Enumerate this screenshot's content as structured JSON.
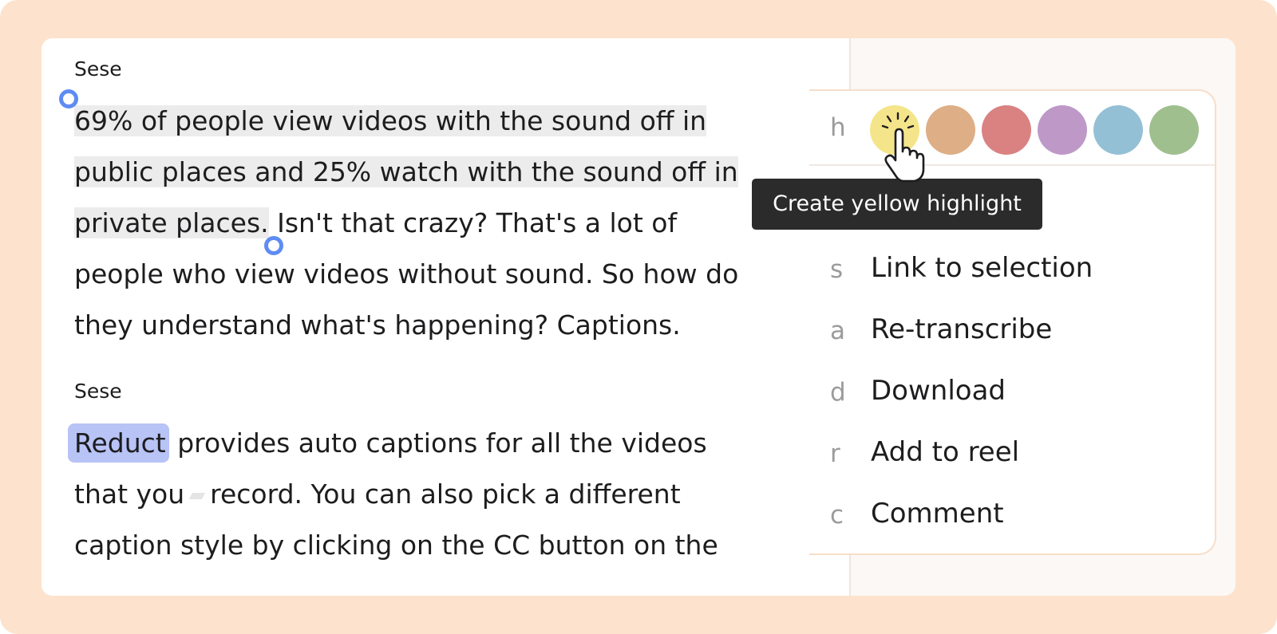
{
  "transcript": {
    "blocks": [
      {
        "speaker": "Sese",
        "lines": [
          {
            "selected": "69% of people view videos with the sound off in",
            "rest": ""
          },
          {
            "selected": "public places and 25% watch with the sound off in",
            "rest": ""
          },
          {
            "selected": "private places.",
            "rest": " Isn't that crazy? That's a lot of"
          },
          {
            "selected": "",
            "rest": "people who view videos without sound. So how do"
          },
          {
            "selected": "",
            "rest": "they understand what's happening? Captions."
          }
        ]
      },
      {
        "speaker": "Sese",
        "highlighted_word": "Reduct",
        "lines": [
          " provides auto captions for all the videos",
          "that you",
          "record. You can also pick a different",
          "caption style by clicking on the CC button on the"
        ]
      }
    ]
  },
  "highlight_menu": {
    "shortcut_key": "h",
    "colors": [
      {
        "name": "yellow",
        "hex": "#f5e58a"
      },
      {
        "name": "orange",
        "hex": "#deae86"
      },
      {
        "name": "red",
        "hex": "#d98281"
      },
      {
        "name": "purple",
        "hex": "#be99c8"
      },
      {
        "name": "blue",
        "hex": "#94c0d6"
      },
      {
        "name": "green",
        "hex": "#9fbf8f"
      }
    ],
    "tooltip": "Create yellow highlight",
    "items": [
      {
        "key": "s",
        "label": "Link to selection"
      },
      {
        "key": "a",
        "label": "Re-transcribe"
      },
      {
        "key": "d",
        "label": "Download"
      },
      {
        "key": "r",
        "label": "Add to reel"
      },
      {
        "key": "c",
        "label": "Comment"
      }
    ]
  },
  "colors": {
    "background": "#fde3cd",
    "selection": "#ececec",
    "word_highlight": "#b8c3f6",
    "handle": "#5e8cf3",
    "tooltip_bg": "#2b2b2b"
  }
}
